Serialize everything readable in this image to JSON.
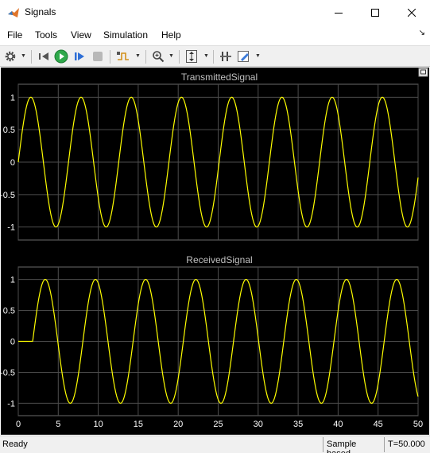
{
  "window": {
    "title": "Signals"
  },
  "menu": [
    "File",
    "Tools",
    "View",
    "Simulation",
    "Help"
  ],
  "toolbar_icons": [
    "gear-icon",
    "back-step-icon",
    "run-icon",
    "step-forward-icon",
    "stop-icon",
    "trigger-icon",
    "zoom-in-icon",
    "scale-axes-icon",
    "cursor-measurement-icon",
    "highlight-icon"
  ],
  "status": {
    "ready": "Ready",
    "mode": "Sample based",
    "time": "T=50.000"
  },
  "colors": {
    "background": "#000000",
    "grid": "#4d4d4d",
    "trace": "#ffff00",
    "tick_text": "#ffffff",
    "title_text": "#c0c0c0"
  },
  "chart_data": [
    {
      "type": "line",
      "title": "TransmittedSignal",
      "xlim": [
        0,
        50
      ],
      "ylim": [
        -1.2,
        1.2
      ],
      "yticks": [
        1,
        0.5,
        0,
        -0.5,
        -1
      ],
      "ytick_labels": [
        "1",
        "0.5",
        "0",
        "-0.5",
        "-1"
      ],
      "xticks": [
        0,
        5,
        10,
        15,
        20,
        25,
        30,
        35,
        40,
        45,
        50
      ],
      "xtick_labels": [],
      "grid": true,
      "series": [
        {
          "function": "sine",
          "amplitude": 1,
          "period": 6.28,
          "delay": 0
        }
      ]
    },
    {
      "type": "line",
      "title": "ReceivedSignal",
      "xlim": [
        0,
        50
      ],
      "ylim": [
        -1.2,
        1.2
      ],
      "yticks": [
        1,
        0.5,
        0,
        -0.5,
        -1
      ],
      "ytick_labels": [
        "1",
        "0.5",
        "0",
        "-0.5",
        "-1"
      ],
      "xticks": [
        0,
        5,
        10,
        15,
        20,
        25,
        30,
        35,
        40,
        45,
        50
      ],
      "xtick_labels": [
        "0",
        "5",
        "10",
        "15",
        "20",
        "25",
        "30",
        "35",
        "40",
        "45",
        "50"
      ],
      "grid": true,
      "series": [
        {
          "function": "sine",
          "amplitude": 1,
          "period": 6.28,
          "delay": 1.8
        }
      ]
    }
  ]
}
